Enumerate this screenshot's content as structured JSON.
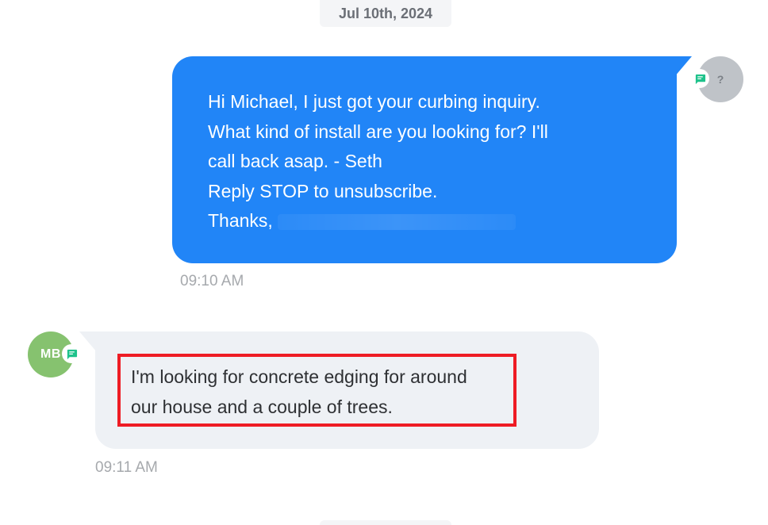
{
  "date_separator": {
    "label": "Jul 10th, 2024"
  },
  "outgoing_message": {
    "lines": [
      "Hi Michael, I just got your curbing inquiry.",
      "What kind of install are you looking for? I'll",
      "call back asap. - Seth",
      "Reply STOP to unsubscribe.",
      "Thanks,"
    ],
    "timestamp": "09:10 AM",
    "avatar_initials": "?",
    "channel_icon": "sms-icon",
    "bubble_color": "#2185f7"
  },
  "incoming_message": {
    "lines": [
      "I'm looking for concrete edging for around",
      "our house and a couple of trees."
    ],
    "timestamp": "09:11 AM",
    "avatar_initials": "MB",
    "avatar_color": "#86c26f",
    "channel_icon": "sms-icon",
    "highlight_color": "#ee1c24",
    "bubble_color": "#eef1f5"
  },
  "colors": {
    "sms_badge_green": "#1ec28b",
    "timestamp_gray": "#a6a9ad"
  }
}
